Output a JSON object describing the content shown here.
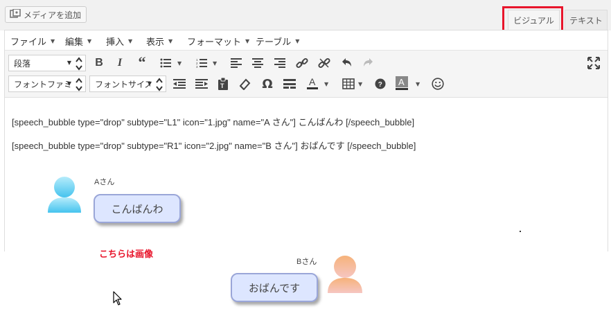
{
  "top": {
    "media_button_label": "メディアを追加",
    "tab_visual": "ビジュアル",
    "tab_text": "テキスト"
  },
  "menubar": [
    "ファイル",
    "編集",
    "挿入",
    "表示",
    "フォーマット",
    "テーブル"
  ],
  "toolbar": {
    "format_select": "段落",
    "font_family_select": "フォントファミリー",
    "font_size_select": "フォントサイズ"
  },
  "content": {
    "line1": "[speech_bubble type=\"drop\" subtype=\"L1\" icon=\"1.jpg\" name=\"A さん\"] こんばんわ [/speech_bubble]",
    "line2": "[speech_bubble type=\"drop\" subtype=\"R1\" icon=\"2.jpg\" name=\"B さん\"] おばんです [/speech_bubble]"
  },
  "preview": {
    "a_name": "Aさん",
    "a_text": "こんばんわ",
    "a_color": "#5ec8ef",
    "b_name": "Bさん",
    "b_text": "おばんです",
    "b_color": "#f4b48e"
  },
  "annotation": "こちらは画像",
  "colors": {
    "highlight": "#e8152b",
    "bubble_fill": "#dde6ff",
    "bubble_border": "#9aa6d8"
  }
}
